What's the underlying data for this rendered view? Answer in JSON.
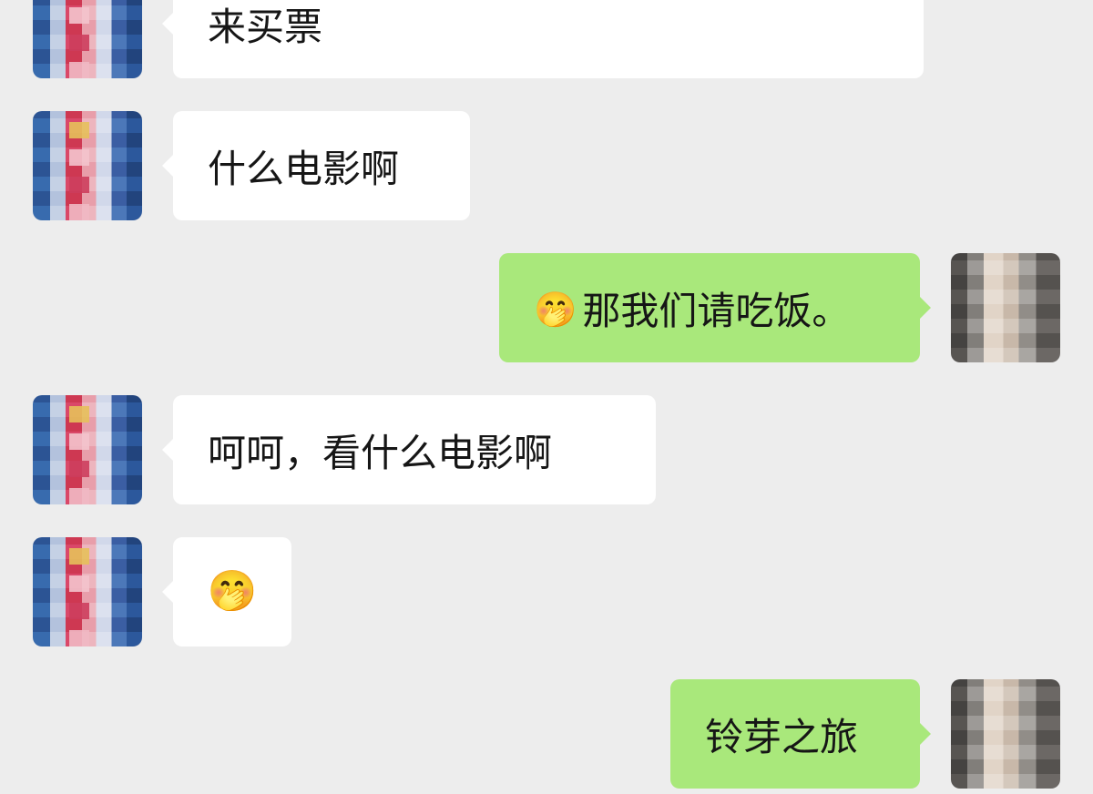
{
  "messages": [
    {
      "side": "left",
      "text": "来买票",
      "emoji": null
    },
    {
      "side": "left",
      "text": "什么电影啊",
      "emoji": null
    },
    {
      "side": "right",
      "text": "那我们请吃饭。",
      "emoji": "🤭"
    },
    {
      "side": "left",
      "text": "呵呵，看什么电影啊",
      "emoji": null
    },
    {
      "side": "left",
      "text": "",
      "emoji": "🤭"
    },
    {
      "side": "right",
      "text": "铃芽之旅",
      "emoji": null
    }
  ]
}
